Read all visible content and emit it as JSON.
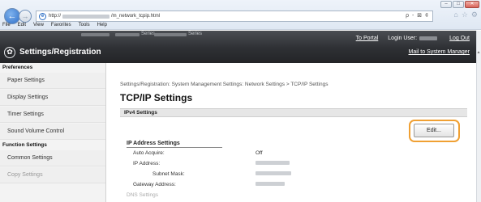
{
  "browser": {
    "window_buttons": [
      "–",
      "□",
      "✕"
    ],
    "address_prefix": "http://",
    "address_suffix": "/m_network_tcpip.html",
    "address_controls": "ρ - ⊠ ¢",
    "menu": [
      "File",
      "Edit",
      "View",
      "Favorites",
      "Tools",
      "Help"
    ]
  },
  "header": {
    "series1": "Series",
    "series2": "Series",
    "title": "Settings/Registration",
    "to_portal": "To Portal",
    "login_user_label": "Login User:",
    "log_out": "Log Out",
    "mail_link": "Mail to System Manager"
  },
  "sidebar": {
    "sections": [
      {
        "heading": "Preferences",
        "items": [
          "Paper Settings",
          "Display Settings",
          "Timer Settings",
          "Sound Volume Control"
        ]
      },
      {
        "heading": "Function Settings",
        "items": [
          "Common Settings",
          "Copy Settings"
        ]
      }
    ]
  },
  "main": {
    "breadcrumb": "Settings/Registration: System Management Settings: Network Settings > TCP/IP Settings",
    "title": "TCP/IP Settings",
    "section": "IPv4 Settings",
    "edit_button": "Edit...",
    "ip_heading": "IP Address Settings",
    "rows": [
      {
        "label": "Auto Acquire:",
        "value": "Off"
      },
      {
        "label": "IP Address:",
        "value": ""
      },
      {
        "label": "Subnet Mask:",
        "value": ""
      },
      {
        "label": "Gateway Address:",
        "value": ""
      },
      {
        "label": "DNS Settings",
        "value": ""
      }
    ]
  },
  "colors": {
    "highlight_ring": "#f0a033",
    "header_dark": "#2e3034"
  }
}
